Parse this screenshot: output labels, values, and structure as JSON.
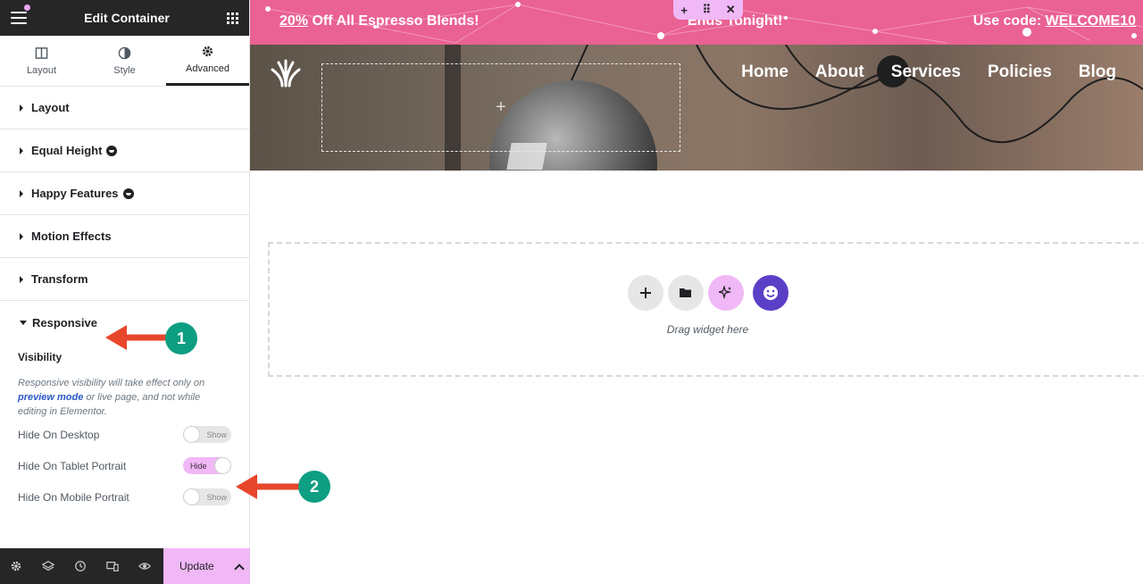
{
  "sidebar": {
    "title": "Edit Container",
    "tabs": [
      {
        "label": "Layout"
      },
      {
        "label": "Style"
      },
      {
        "label": "Advanced"
      }
    ],
    "sections": [
      {
        "label": "Layout"
      },
      {
        "label": "Equal Height"
      },
      {
        "label": "Happy Features"
      },
      {
        "label": "Motion Effects"
      },
      {
        "label": "Transform"
      },
      {
        "label": "Responsive"
      }
    ],
    "responsive": {
      "visibility_label": "Visibility",
      "note_prefix": "Responsive visibility will take effect only on",
      "note_link": "preview mode",
      "note_suffix": "or live page, and not while editing in Elementor.",
      "controls": [
        {
          "label": "Hide On Desktop",
          "state": "Show"
        },
        {
          "label": "Hide On Tablet Portrait",
          "state": "Hide"
        },
        {
          "label": "Hide On Mobile Portrait",
          "state": "Show"
        }
      ]
    },
    "footer": {
      "update_label": "Update"
    }
  },
  "canvas": {
    "banner": {
      "part1_link": "20%",
      "part1_rest": "Off All Espresso Blends!",
      "part2": "Ends Tonight!",
      "part3_prefix": "Use code:",
      "part3_code": "WELCOME10"
    },
    "container_tools": {
      "add": "+",
      "move": "⠿",
      "close": "✕"
    },
    "nav": [
      "Home",
      "About",
      "Services",
      "Policies",
      "Blog"
    ],
    "placeholder_plus": "+",
    "dropzone_text": "Drag widget here"
  },
  "annotations": [
    "1",
    "2"
  ],
  "colors": {
    "accent_pink": "#f0b8f6",
    "banner_pink": "#ea6193",
    "badge_green": "#0e9e82",
    "arrow_red": "#e8462b",
    "dark": "#262626"
  }
}
